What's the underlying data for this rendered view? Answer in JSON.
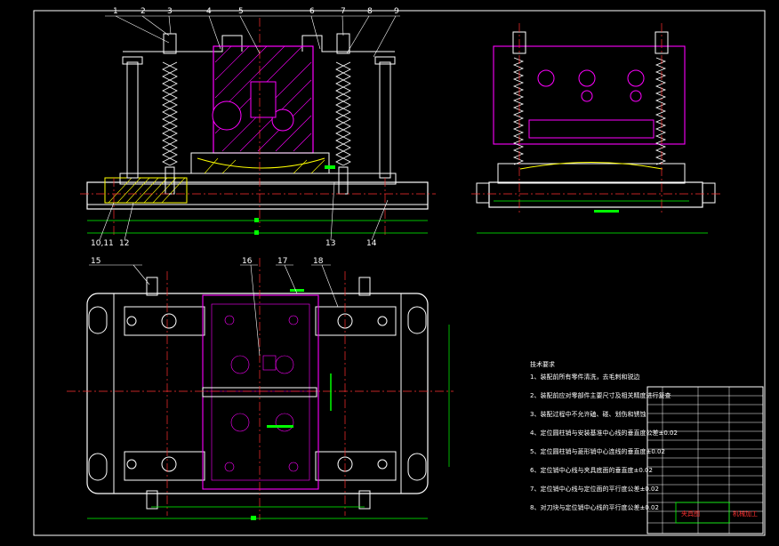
{
  "colors": {
    "background": "#000000",
    "line": "#ffffff",
    "part": "#ff00ff",
    "center": "#ff3030",
    "dim": "#00ff00",
    "hatch": "#ffff00"
  },
  "callouts_top": [
    "1",
    "2",
    "3",
    "4",
    "5",
    "6",
    "7",
    "8",
    "9"
  ],
  "callouts_bottom": [
    "10,11",
    "12",
    "13",
    "14"
  ],
  "callouts_plan": [
    "15",
    "16",
    "17",
    "18"
  ],
  "notes": {
    "title": "技术要求",
    "items": [
      "1、装配前所有零件清洗，去毛刺和锐边",
      "2、装配前应对零部件主要尺寸及相关精度进行复查",
      "3、装配过程中不允许磕、碰、划伤和锈蚀",
      "4、定位圆柱销与安装基准中心线的垂直度公差±0.02",
      "5、定位圆柱销与菱形销中心连线的垂直度±0.02",
      "6、定位销中心线与夹具底面的垂直度±0.02",
      "7、定位销中心线与定位面的平行度公差±0.02",
      "8、对刀块与定位销中心线的平行度公差±0.02"
    ]
  },
  "title_block": {
    "cell_a": "夹具图",
    "cell_b": "机械加工"
  }
}
